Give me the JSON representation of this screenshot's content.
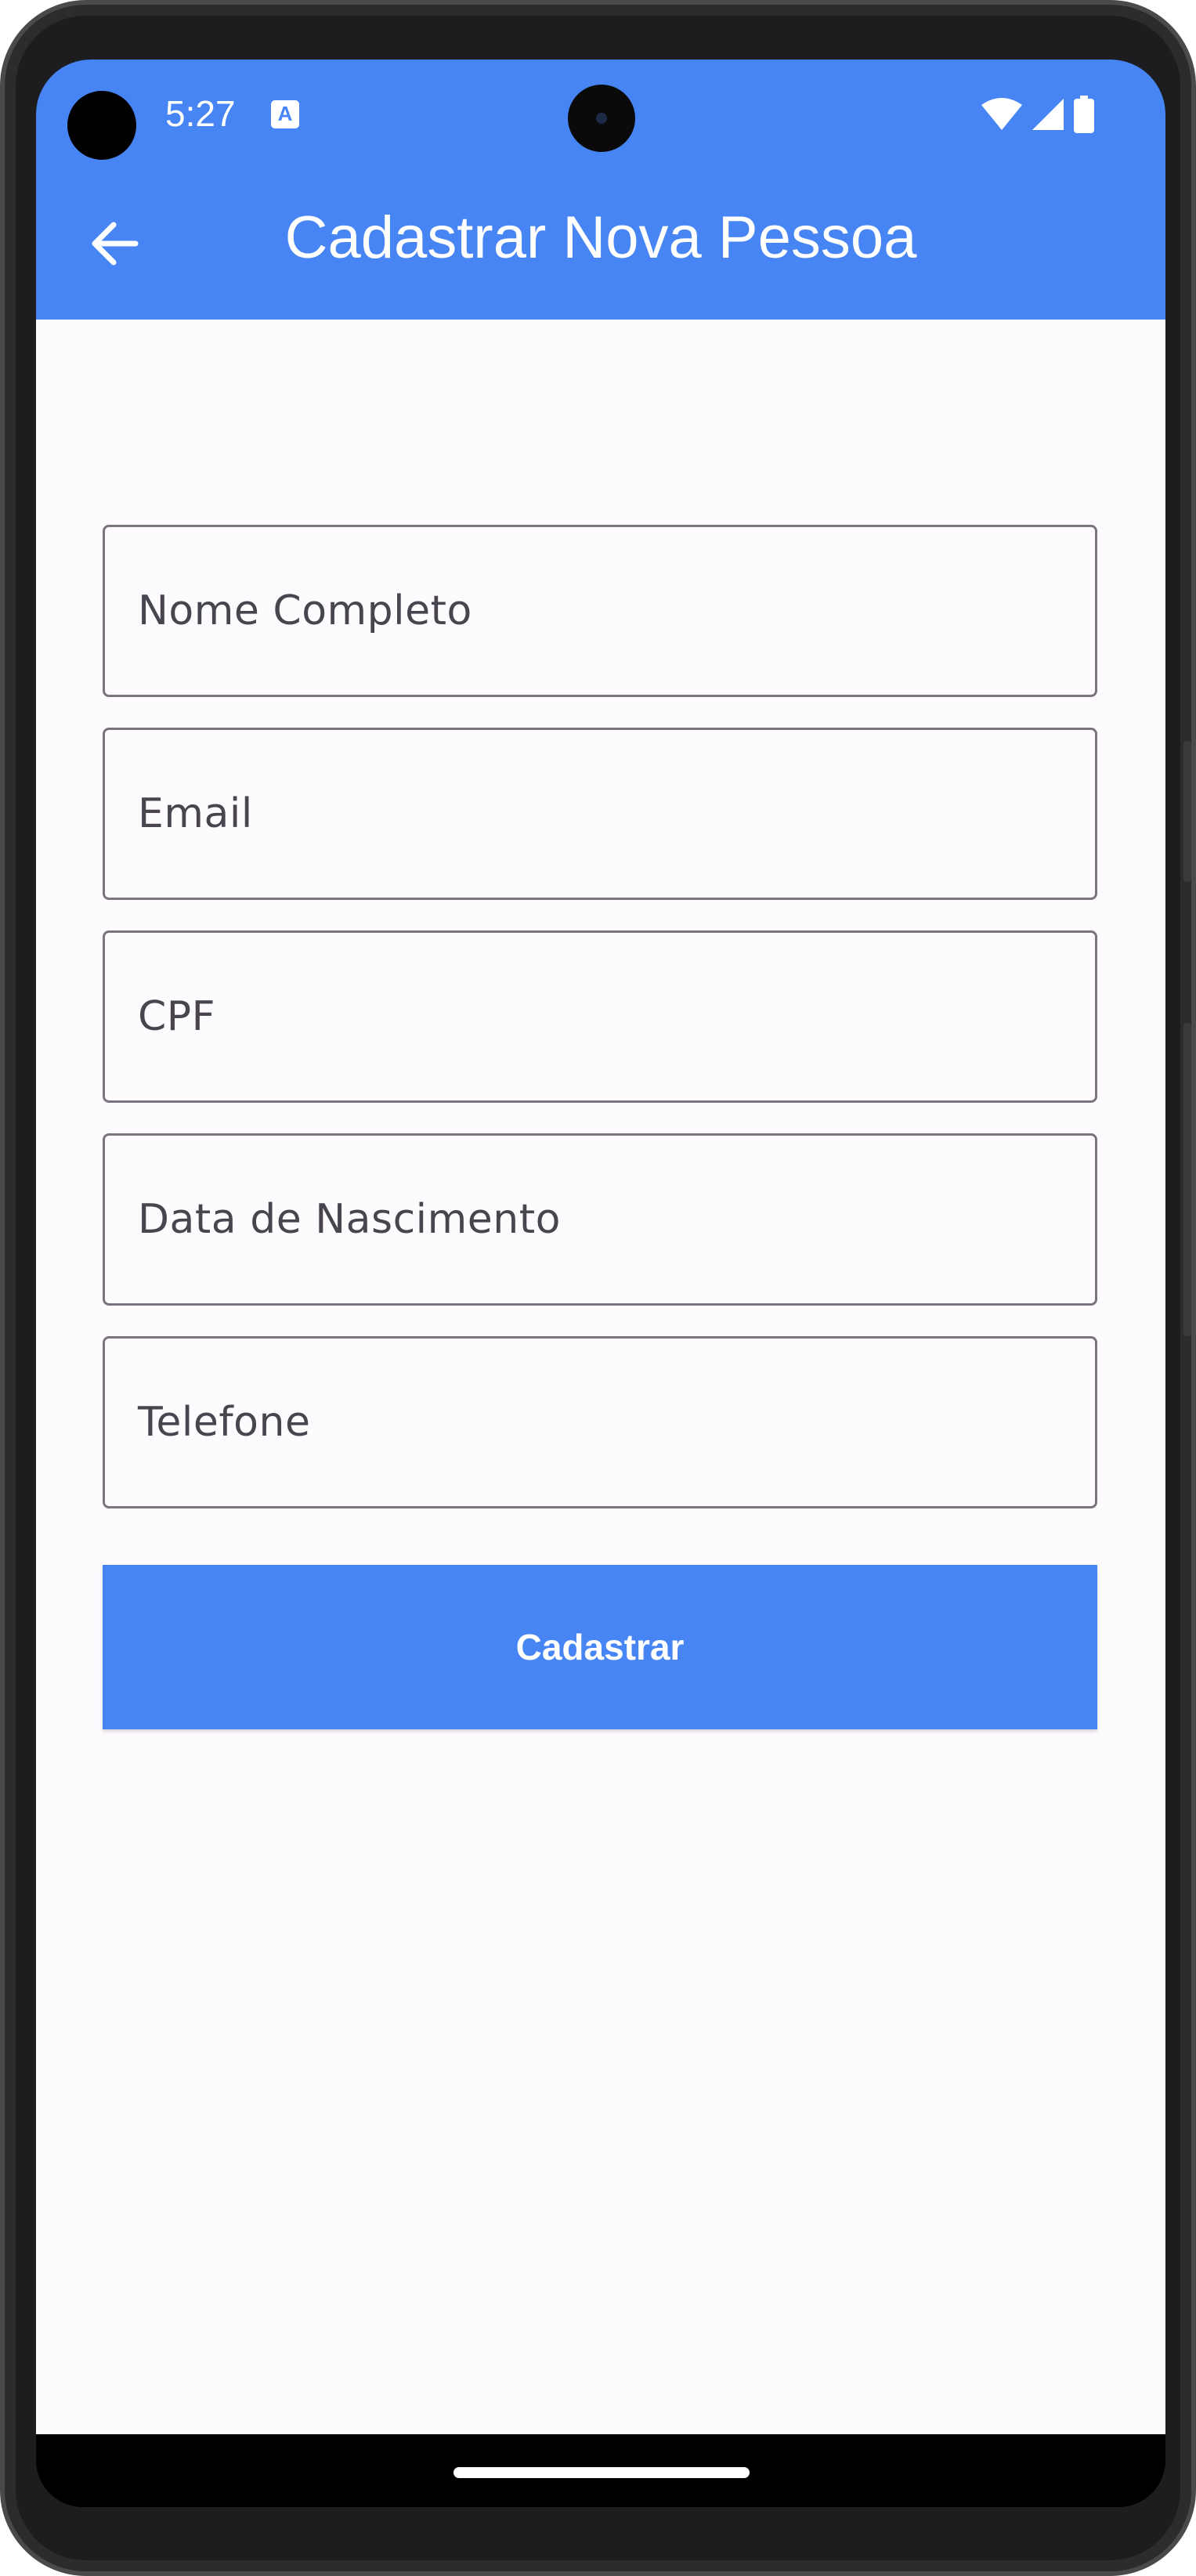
{
  "status_bar": {
    "time": "5:27",
    "app_icon_glyph": "A",
    "icons": [
      "wifi-icon",
      "signal-icon",
      "battery-icon"
    ]
  },
  "app_bar": {
    "title": "Cadastrar Nova Pessoa",
    "back_icon": "arrow-left-icon"
  },
  "form": {
    "fields": [
      {
        "label": "Nome Completo",
        "value": ""
      },
      {
        "label": "Email",
        "value": ""
      },
      {
        "label": "CPF",
        "value": ""
      },
      {
        "label": "Data de Nascimento",
        "value": ""
      },
      {
        "label": "Telefone",
        "value": ""
      }
    ],
    "submit_label": "Cadastrar"
  },
  "colors": {
    "primary": "#4785f5",
    "background": "#fefbff",
    "outline": "#79747e",
    "label": "#49454f"
  }
}
